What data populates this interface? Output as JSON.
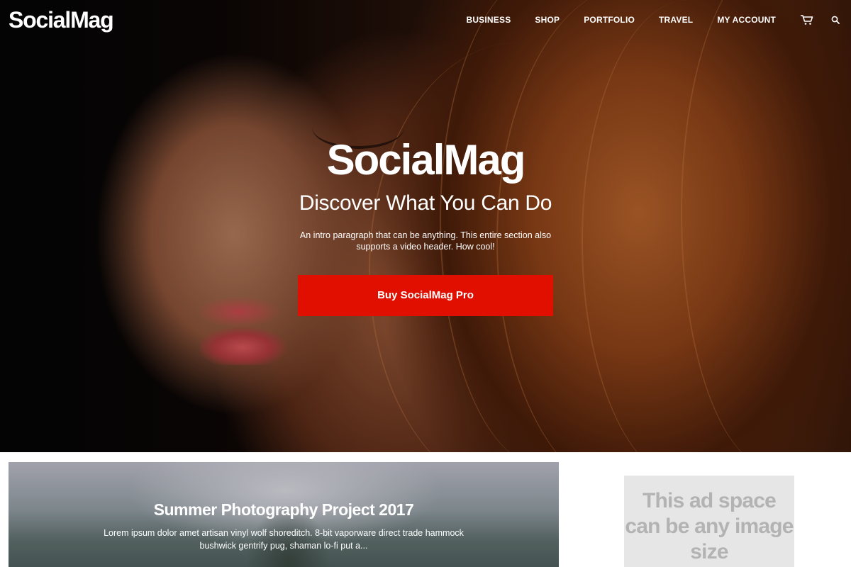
{
  "header": {
    "logo": "SocialMag",
    "nav": [
      "BUSINESS",
      "SHOP",
      "PORTFOLIO",
      "TRAVEL",
      "MY ACCOUNT"
    ],
    "icons": [
      "cart-icon",
      "search-icon"
    ]
  },
  "hero": {
    "title": "SocialMag",
    "subtitle": "Discover What You Can Do",
    "intro": "An intro paragraph that can be anything. This entire section also supports a video header. How cool!",
    "cta_label": "Buy SocialMag Pro",
    "cta_color": "#e00f00"
  },
  "featured_post": {
    "title": "Summer Photography Project 2017",
    "excerpt": "Lorem ipsum dolor amet artisan vinyl wolf shoreditch. 8-bit vaporware direct trade hammock bushwick gentrify pug, shaman lo-fi put a..."
  },
  "ad": {
    "text": "This ad space can be any image size"
  }
}
